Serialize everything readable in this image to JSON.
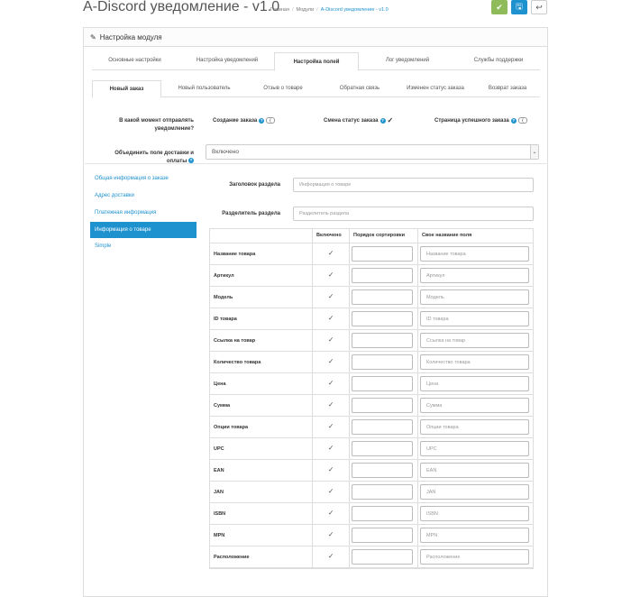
{
  "header": {
    "title": "A-Discord уведомление - v1.0",
    "breadcrumbs": [
      "Главная",
      "Модули",
      "A-Discord уведомление - v1.0"
    ],
    "buttons": {
      "save": "✔",
      "save_stay": "🖫",
      "back": "↩"
    }
  },
  "panel_title": "Настройка модуля",
  "main_tabs": [
    "Основные настройки",
    "Настройка уведомлений",
    "Настройка полей",
    "Лог уведомлений",
    "Службы поддержки"
  ],
  "sub_tabs": [
    "Новый заказ",
    "Новый пользователь",
    "Отзыв о товаре",
    "Обратная связь",
    "Изменен статус заказа",
    "Возврат заказа"
  ],
  "moment": {
    "label_line1": "В какой момент отправлять",
    "label_line2": "уведомление?",
    "options": [
      "Создание заказа",
      "Смена статус заказа",
      "Страница успешного заказа"
    ]
  },
  "combine": {
    "label_line1": "Объединить поле доставки и",
    "label_line2": "оплаты",
    "value": "Включено"
  },
  "sidebar": [
    "Общая информация о заказе",
    "Адрес доставки",
    "Платежная информация",
    "Информация о товаре",
    "Simple"
  ],
  "section_title": {
    "label": "Заголовок раздела",
    "placeholder": "Информация о товаре"
  },
  "section_sep": {
    "label": "Разделитель раздела",
    "placeholder": "Разделитель раздела"
  },
  "table": {
    "headers": [
      "Включено",
      "Порядок сортировки",
      "Свое название поля"
    ],
    "rows": [
      {
        "name": "Название товара",
        "placeholder": "Название товара"
      },
      {
        "name": "Артикул",
        "placeholder": "Артикул"
      },
      {
        "name": "Модель",
        "placeholder": "Модель"
      },
      {
        "name": "ID товара",
        "placeholder": "ID товара"
      },
      {
        "name": "Ссылка на товар",
        "placeholder": "Ссылка на товар"
      },
      {
        "name": "Количество товара",
        "placeholder": "Количество товара"
      },
      {
        "name": "Цена",
        "placeholder": "Цена"
      },
      {
        "name": "Сумма",
        "placeholder": "Сумма"
      },
      {
        "name": "Опции товара",
        "placeholder": "Опции товара"
      },
      {
        "name": "UPC",
        "placeholder": "UPC"
      },
      {
        "name": "EAN",
        "placeholder": "EAN"
      },
      {
        "name": "JAN",
        "placeholder": "JAN"
      },
      {
        "name": "ISBN",
        "placeholder": "ISBN"
      },
      {
        "name": "MPN",
        "placeholder": "MPN"
      },
      {
        "name": "Расположение",
        "placeholder": "Расположение"
      }
    ]
  },
  "colors": {
    "accent": "#1e91cf",
    "success": "#8fbb5a"
  }
}
